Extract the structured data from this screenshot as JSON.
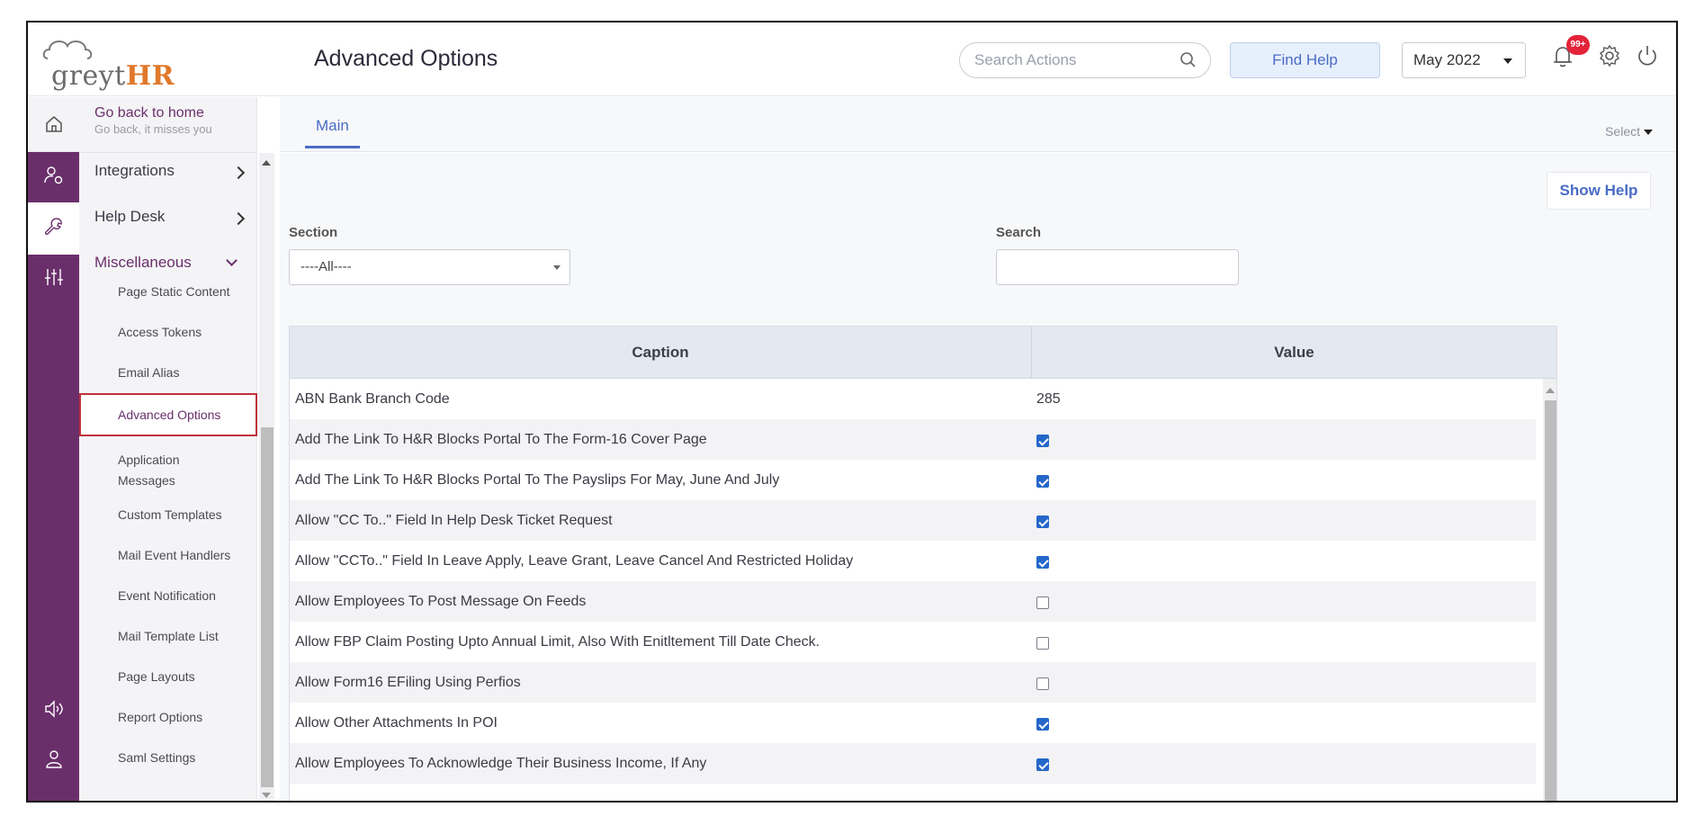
{
  "app": {
    "logo_prefix": "greyt",
    "logo_suffix": "HR",
    "page_title": "Advanced Options"
  },
  "header": {
    "search_placeholder": "Search Actions",
    "find_help_label": "Find Help",
    "month_value": "May 2022",
    "notification_count": "99+"
  },
  "sidebar": {
    "home_title": "Go back to home",
    "home_subtitle": "Go back, it misses you",
    "groups": [
      {
        "label": "Integrations"
      },
      {
        "label": "Help Desk"
      },
      {
        "label": "Miscellaneous"
      }
    ],
    "items": [
      {
        "label": "Page Static Content"
      },
      {
        "label": "Access Tokens"
      },
      {
        "label": "Email Alias"
      },
      {
        "label": "Advanced Options"
      },
      {
        "label": "Application Messages"
      },
      {
        "label": "Custom Templates"
      },
      {
        "label": "Mail Event Handlers"
      },
      {
        "label": "Event Notification"
      },
      {
        "label": "Mail Template List"
      },
      {
        "label": "Page Layouts"
      },
      {
        "label": "Report Options"
      },
      {
        "label": "Saml Settings"
      }
    ],
    "active_item": "Advanced Options"
  },
  "tabs": {
    "main_label": "Main",
    "select_label": "Select"
  },
  "filters": {
    "show_help_label": "Show Help",
    "section_label": "Section",
    "section_value": "----All----",
    "search_label": "Search",
    "search_value": ""
  },
  "table": {
    "columns": [
      "Caption",
      "Value"
    ],
    "rows": [
      {
        "caption": "ABN Bank Branch Code",
        "type": "text",
        "value": "285"
      },
      {
        "caption": "Add The Link To H&R Blocks Portal To The Form-16 Cover Page",
        "type": "checkbox",
        "checked": true
      },
      {
        "caption": "Add The Link To H&R Blocks Portal To The Payslips For May, June And July",
        "type": "checkbox",
        "checked": true
      },
      {
        "caption": "Allow \"CC To..\" Field In Help Desk Ticket Request",
        "type": "checkbox",
        "checked": true
      },
      {
        "caption": "Allow \"CCTo..\" Field In Leave Apply, Leave Grant, Leave Cancel And Restricted Holiday",
        "type": "checkbox",
        "checked": true
      },
      {
        "caption": "Allow Employees To Post Message On Feeds",
        "type": "checkbox",
        "checked": false
      },
      {
        "caption": "Allow FBP Claim Posting Upto Annual Limit, Also With Enitltement Till Date Check.",
        "type": "checkbox",
        "checked": false
      },
      {
        "caption": "Allow Form16 EFiling Using Perfios",
        "type": "checkbox",
        "checked": false
      },
      {
        "caption": "Allow Other Attachments In POI",
        "type": "checkbox",
        "checked": true
      },
      {
        "caption": "Allow Employees To Acknowledge Their Business Income, If Any",
        "type": "checkbox",
        "checked": true
      }
    ]
  },
  "colors": {
    "brand_purple": "#6a2f6b",
    "accent_blue": "#4a6cc5",
    "active_border": "#c0303b",
    "badge_red": "#e3243b",
    "logo_orange": "#e0782a"
  }
}
